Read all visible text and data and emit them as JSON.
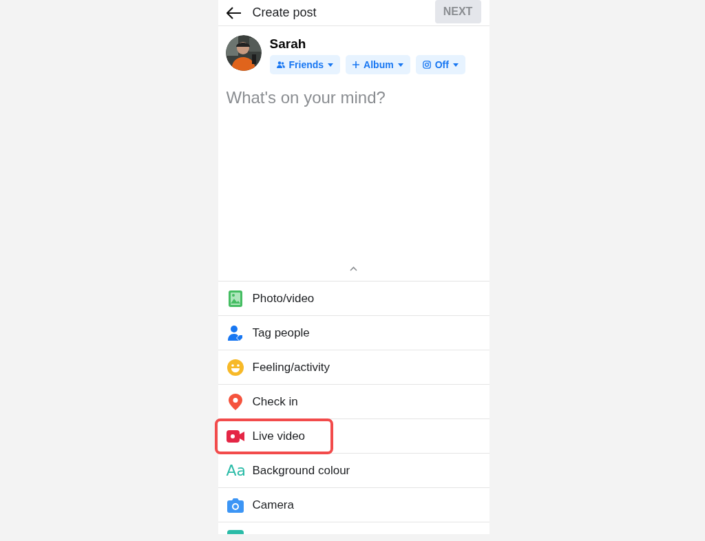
{
  "header": {
    "title": "Create post",
    "next_button": "NEXT",
    "next_disabled": true
  },
  "profile": {
    "name": "Sarah",
    "chips": [
      {
        "kind": "audience",
        "label": "Friends"
      },
      {
        "kind": "album",
        "label": "Album"
      },
      {
        "kind": "instagram",
        "label": "Off"
      }
    ]
  },
  "composer": {
    "placeholder": "What's on your mind?"
  },
  "options": [
    {
      "label": "Photo/video",
      "highlighted": false
    },
    {
      "kind": "tag",
      "label": "Tag people",
      "highlighted": false
    },
    {
      "kind": "feeling",
      "label": "Feeling/activity",
      "highlighted": false
    },
    {
      "kind": "checkin",
      "label": "Check in",
      "highlighted": false
    },
    {
      "kind": "live",
      "label": "Live video",
      "highlighted": true
    },
    {
      "kind": "background",
      "label": "Background colour",
      "icon_text": "Aa",
      "highlighted": false
    },
    {
      "kind": "camera",
      "label": "Camera",
      "highlighted": false
    },
    {
      "kind": "partial",
      "highlighted": false
    }
  ]
}
